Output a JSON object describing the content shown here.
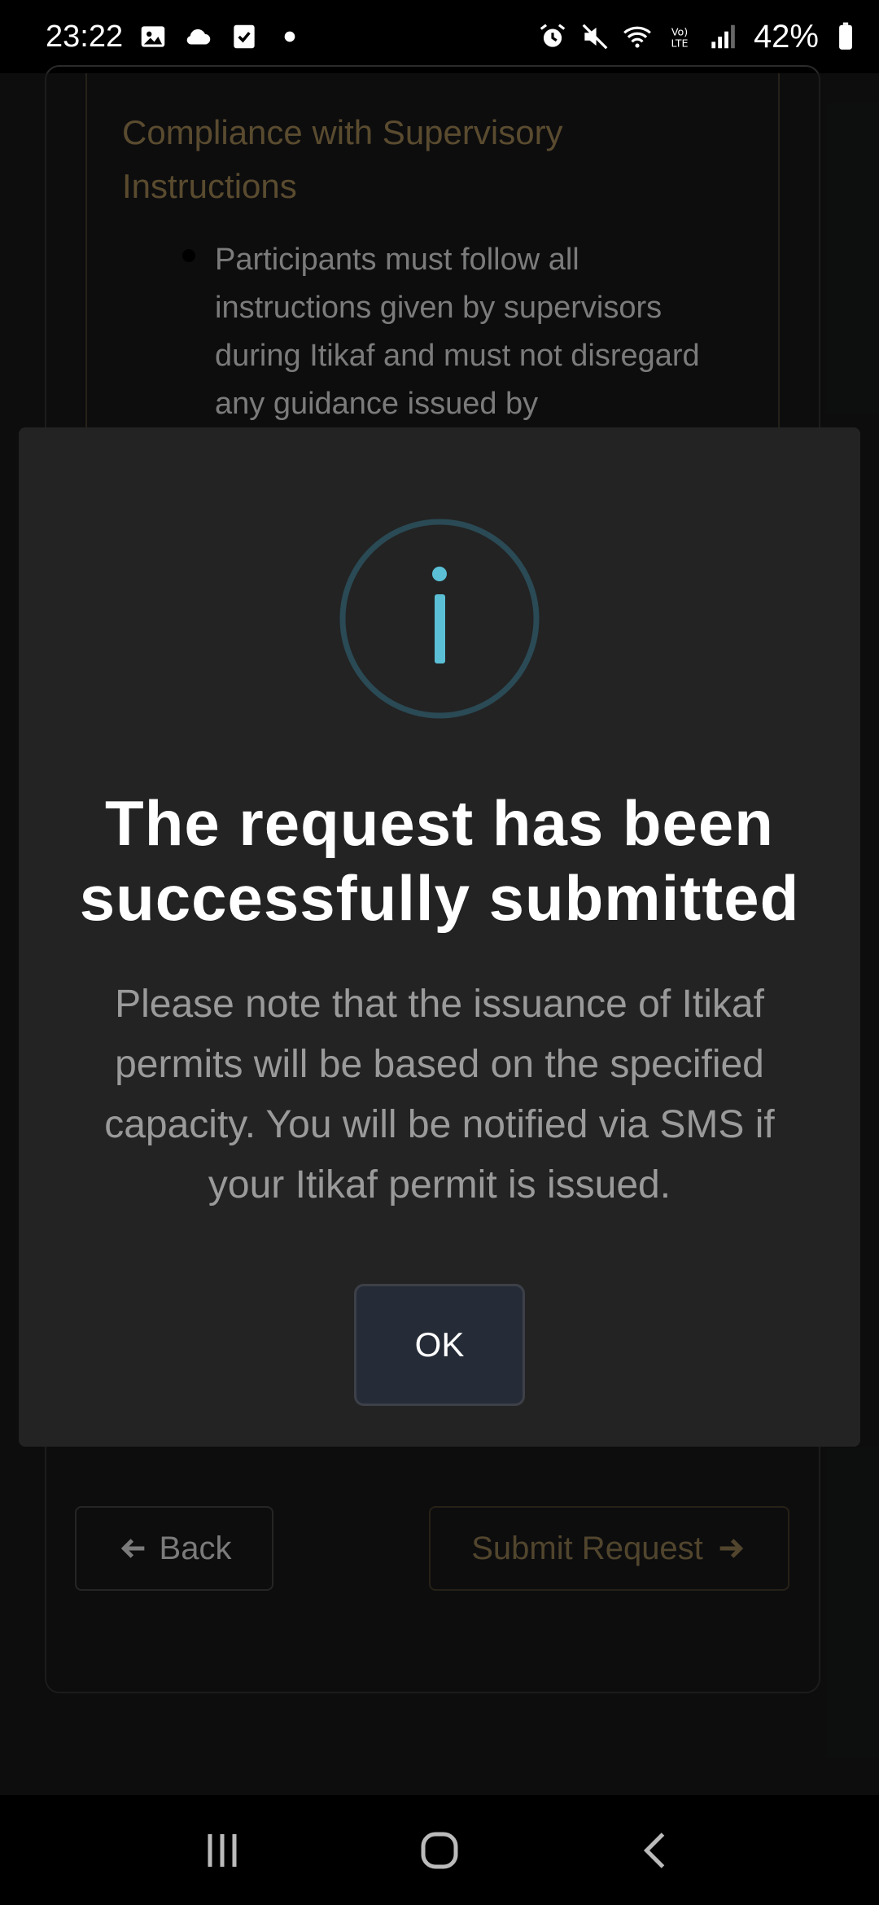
{
  "status_bar": {
    "time": "23:22",
    "battery": "42%",
    "left_icons": [
      "image-icon",
      "cloud-icon",
      "checkbox-icon",
      "dot-icon"
    ],
    "right_icons": [
      "alarm-icon",
      "mute-icon",
      "wifi-icon",
      "volte-icon",
      "signal-icon",
      "battery-icon"
    ]
  },
  "background_page": {
    "section_title": "Compliance with Supervisory Instructions",
    "bullet_text": "Participants must follow all instructions given by supervisors during Itikaf and must not disregard any guidance issued by",
    "back_label": "Back",
    "submit_label": "Submit Request"
  },
  "modal": {
    "icon": "info-icon",
    "title": "The request has been successfully submitted",
    "message": "Please note that the issuance of Itikaf permits will be based on the specified capacity. You will be notified via SMS if your Itikaf permit is issued.",
    "ok_label": "OK"
  },
  "nav_bar": {
    "buttons": [
      "recent-apps-icon",
      "home-icon",
      "back-icon"
    ]
  },
  "colors": {
    "accent_gold": "#8a7449",
    "info_blue": "#5bbfd5",
    "modal_bg": "#232323",
    "ok_button_bg": "#252c37"
  }
}
